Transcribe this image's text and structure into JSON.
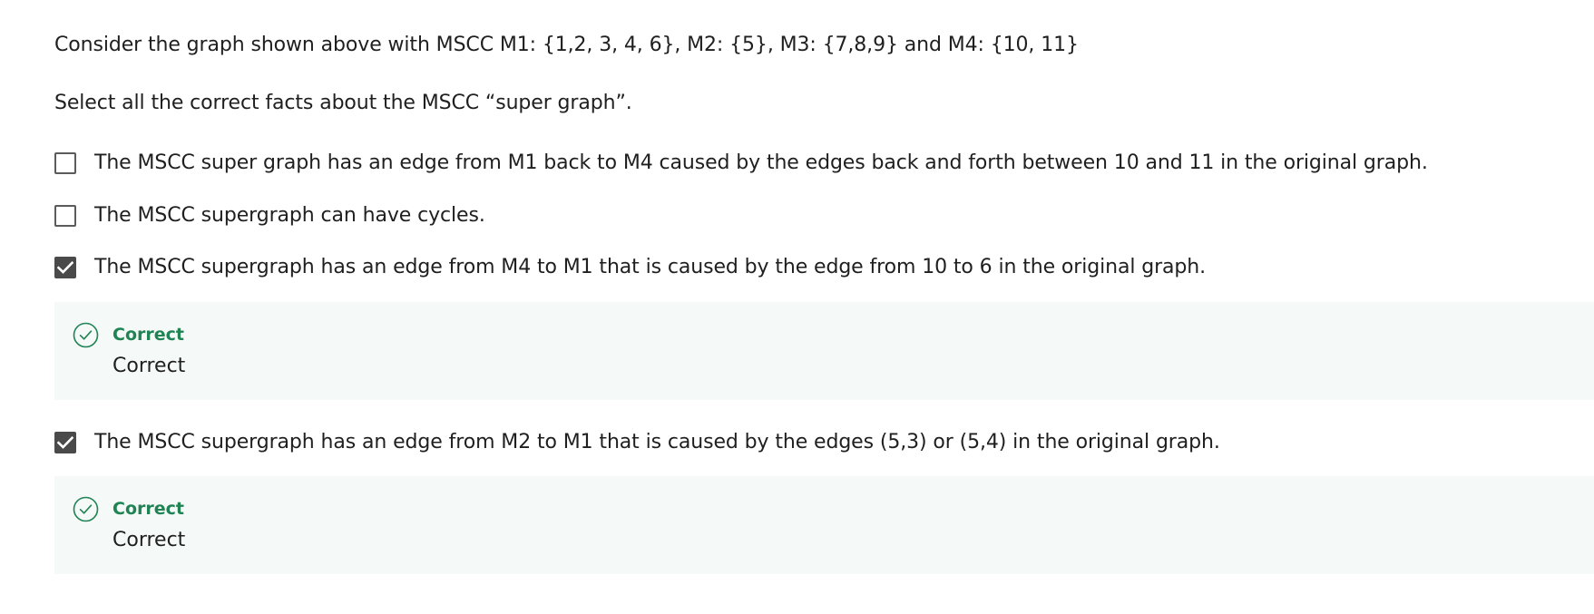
{
  "question": {
    "prompt_line1": "Consider the graph shown above with MSCC M1: {1,2, 3, 4, 6}, M2: {5}, M3: {7,8,9} and M4: {10, 11}",
    "prompt_line2": "Select all the correct facts about the MSCC “super graph”."
  },
  "options": [
    {
      "label": "The MSCC super graph has an edge from M1 back to M4 caused by the edges back and forth between 10 and 11 in the original graph.",
      "checked": false
    },
    {
      "label": "The MSCC supergraph can have cycles.",
      "checked": false
    },
    {
      "label": "The MSCC supergraph has an edge from M4 to M1 that is caused by the edge from 10 to 6 in the original graph.",
      "checked": true,
      "feedback": {
        "title": "Correct",
        "body": "Correct",
        "icon": "check-circle-icon"
      }
    },
    {
      "label": "The MSCC supergraph has an edge from M2 to M1 that is caused by the edges (5,3) or (5,4) in the original graph.",
      "checked": true,
      "feedback": {
        "title": "Correct",
        "body": "Correct",
        "icon": "check-circle-icon"
      }
    }
  ],
  "colors": {
    "correct_green": "#1f8354",
    "feedback_background": "#f5f9f8",
    "checkbox_checked": "#4a4a4a",
    "text": "#1f1f1f"
  }
}
